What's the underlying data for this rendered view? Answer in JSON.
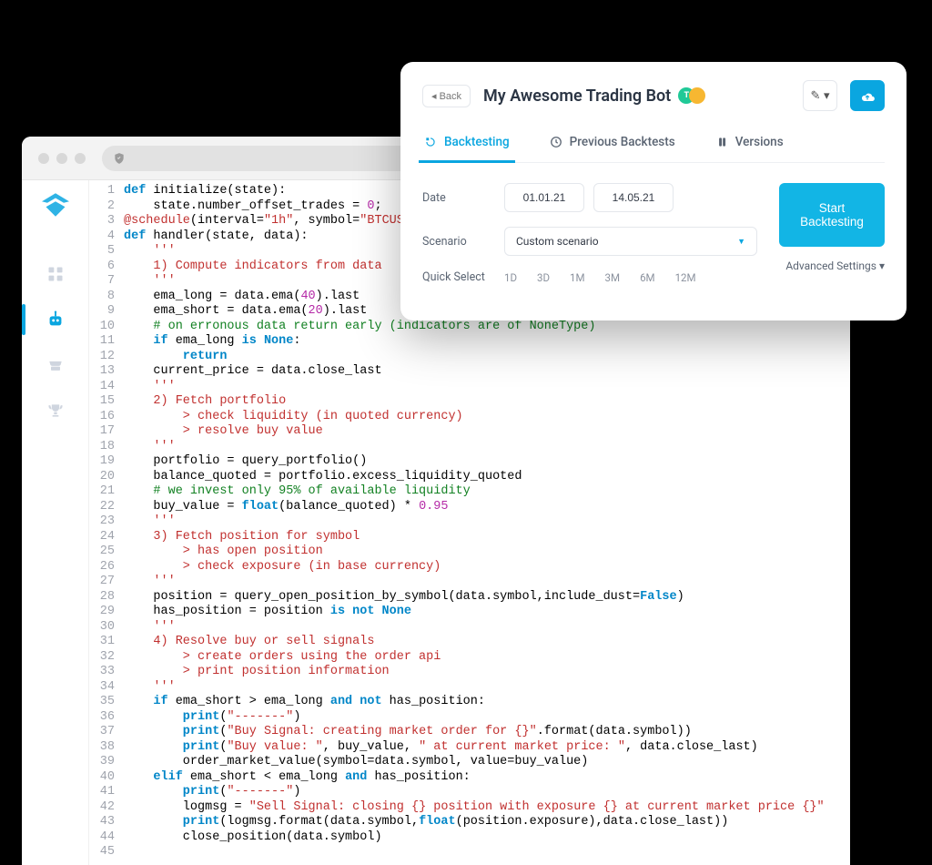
{
  "card": {
    "back": "Back",
    "title": "My Awesome Trading Bot",
    "tabs": [
      {
        "label": "Backtesting",
        "active": true
      },
      {
        "label": "Previous Backtests",
        "active": false
      },
      {
        "label": "Versions",
        "active": false
      }
    ],
    "form": {
      "date_label": "Date",
      "date_from": "01.01.21",
      "date_to": "14.05.21",
      "scenario_label": "Scenario",
      "scenario_value": "Custom scenario",
      "quick_label": "Quick Select",
      "quick_options": [
        "1D",
        "3D",
        "1M",
        "3M",
        "6M",
        "12M"
      ]
    },
    "start_button": "Start Backtesting",
    "advanced": "Advanced Settings ▾"
  },
  "code": {
    "lines": [
      [
        {
          "t": "def ",
          "c": "kw"
        },
        {
          "t": "initialize(state):",
          "c": ""
        }
      ],
      [
        {
          "t": "    state.number_offset_trades = ",
          "c": ""
        },
        {
          "t": "0",
          "c": "num"
        },
        {
          "t": ";",
          "c": ""
        }
      ],
      [
        {
          "t": "@schedule",
          "c": "dec"
        },
        {
          "t": "(interval=",
          "c": ""
        },
        {
          "t": "\"1h\"",
          "c": "str"
        },
        {
          "t": ", symbol=",
          "c": ""
        },
        {
          "t": "\"BTCUSDT\"",
          "c": "str"
        },
        {
          "t": ")",
          "c": ""
        }
      ],
      [
        {
          "t": "def ",
          "c": "kw"
        },
        {
          "t": "handler(state, data):",
          "c": ""
        }
      ],
      [
        {
          "t": "    '''",
          "c": "str"
        }
      ],
      [
        {
          "t": "    1) Compute indicators from data",
          "c": "str"
        }
      ],
      [
        {
          "t": "    '''",
          "c": "str"
        }
      ],
      [
        {
          "t": "    ema_long = data.ema(",
          "c": ""
        },
        {
          "t": "40",
          "c": "num"
        },
        {
          "t": ").last",
          "c": ""
        }
      ],
      [
        {
          "t": "    ema_short = data.ema(",
          "c": ""
        },
        {
          "t": "20",
          "c": "num"
        },
        {
          "t": ").last",
          "c": ""
        }
      ],
      [
        {
          "t": "    # on erronous data return early (indicators are of NoneType)",
          "c": "cm"
        }
      ],
      [
        {
          "t": "    if ",
          "c": "kw"
        },
        {
          "t": "ema_long ",
          "c": ""
        },
        {
          "t": "is None",
          "c": "kw"
        },
        {
          "t": ":",
          "c": ""
        }
      ],
      [
        {
          "t": "        return",
          "c": "kw"
        }
      ],
      [
        {
          "t": "    current_price = data.close_last",
          "c": ""
        }
      ],
      [
        {
          "t": "    '''",
          "c": "str"
        }
      ],
      [
        {
          "t": "    2) Fetch portfolio",
          "c": "str"
        }
      ],
      [
        {
          "t": "        > check liquidity (in quoted currency)",
          "c": "str"
        }
      ],
      [
        {
          "t": "        > resolve buy value",
          "c": "str"
        }
      ],
      [
        {
          "t": "    '''",
          "c": "str"
        }
      ],
      [
        {
          "t": "    portfolio = query_portfolio()",
          "c": ""
        }
      ],
      [
        {
          "t": "    balance_quoted = portfolio.excess_liquidity_quoted",
          "c": ""
        }
      ],
      [
        {
          "t": "    # we invest only 95% of available liquidity",
          "c": "cm"
        }
      ],
      [
        {
          "t": "    buy_value = ",
          "c": ""
        },
        {
          "t": "float",
          "c": "kw"
        },
        {
          "t": "(balance_quoted) * ",
          "c": ""
        },
        {
          "t": "0.95",
          "c": "num"
        }
      ],
      [
        {
          "t": "    '''",
          "c": "str"
        }
      ],
      [
        {
          "t": "    3) Fetch position for symbol",
          "c": "str"
        }
      ],
      [
        {
          "t": "        > has open position",
          "c": "str"
        }
      ],
      [
        {
          "t": "        > check exposure (in base currency)",
          "c": "str"
        }
      ],
      [
        {
          "t": "    '''",
          "c": "str"
        }
      ],
      [
        {
          "t": "    position = query_open_position_by_symbol(data.symbol,include_dust=",
          "c": ""
        },
        {
          "t": "False",
          "c": "val"
        },
        {
          "t": ")",
          "c": ""
        }
      ],
      [
        {
          "t": "    has_position = position ",
          "c": ""
        },
        {
          "t": "is not None",
          "c": "kw"
        }
      ],
      [
        {
          "t": "    '''",
          "c": "str"
        }
      ],
      [
        {
          "t": "    4) Resolve buy or sell signals",
          "c": "str"
        }
      ],
      [
        {
          "t": "        > create orders using the order api",
          "c": "str"
        }
      ],
      [
        {
          "t": "        > print position information",
          "c": "str"
        }
      ],
      [
        {
          "t": "    '''",
          "c": "str"
        }
      ],
      [
        {
          "t": "    if ",
          "c": "kw"
        },
        {
          "t": "ema_short > ema_long ",
          "c": ""
        },
        {
          "t": "and not ",
          "c": "kw"
        },
        {
          "t": "has_position:",
          "c": ""
        }
      ],
      [
        {
          "t": "        print",
          "c": "kw"
        },
        {
          "t": "(",
          "c": ""
        },
        {
          "t": "\"-------\"",
          "c": "str"
        },
        {
          "t": ")",
          "c": ""
        }
      ],
      [
        {
          "t": "        print",
          "c": "kw"
        },
        {
          "t": "(",
          "c": ""
        },
        {
          "t": "\"Buy Signal: creating market order for {}\"",
          "c": "str"
        },
        {
          "t": ".format(data.symbol))",
          "c": ""
        }
      ],
      [
        {
          "t": "        print",
          "c": "kw"
        },
        {
          "t": "(",
          "c": ""
        },
        {
          "t": "\"Buy value: \"",
          "c": "str"
        },
        {
          "t": ", buy_value, ",
          "c": ""
        },
        {
          "t": "\" at current market price: \"",
          "c": "str"
        },
        {
          "t": ", data.close_last)",
          "c": ""
        }
      ],
      [
        {
          "t": "        order_market_value(symbol=data.symbol, value=buy_value)",
          "c": ""
        }
      ],
      [
        {
          "t": "    elif ",
          "c": "kw"
        },
        {
          "t": "ema_short < ema_long ",
          "c": ""
        },
        {
          "t": "and ",
          "c": "kw"
        },
        {
          "t": "has_position:",
          "c": ""
        }
      ],
      [
        {
          "t": "        print",
          "c": "kw"
        },
        {
          "t": "(",
          "c": ""
        },
        {
          "t": "\"-------\"",
          "c": "str"
        },
        {
          "t": ")",
          "c": ""
        }
      ],
      [
        {
          "t": "        logmsg = ",
          "c": ""
        },
        {
          "t": "\"Sell Signal: closing {} position with exposure {} at current market price {}\"",
          "c": "str"
        }
      ],
      [
        {
          "t": "        print",
          "c": "kw"
        },
        {
          "t": "(logmsg.format(data.symbol,",
          "c": ""
        },
        {
          "t": "float",
          "c": "kw"
        },
        {
          "t": "(position.exposure),data.close_last))",
          "c": ""
        }
      ],
      [
        {
          "t": "        close_position(data.symbol)",
          "c": ""
        }
      ],
      [
        {
          "t": "",
          "c": ""
        }
      ]
    ]
  }
}
